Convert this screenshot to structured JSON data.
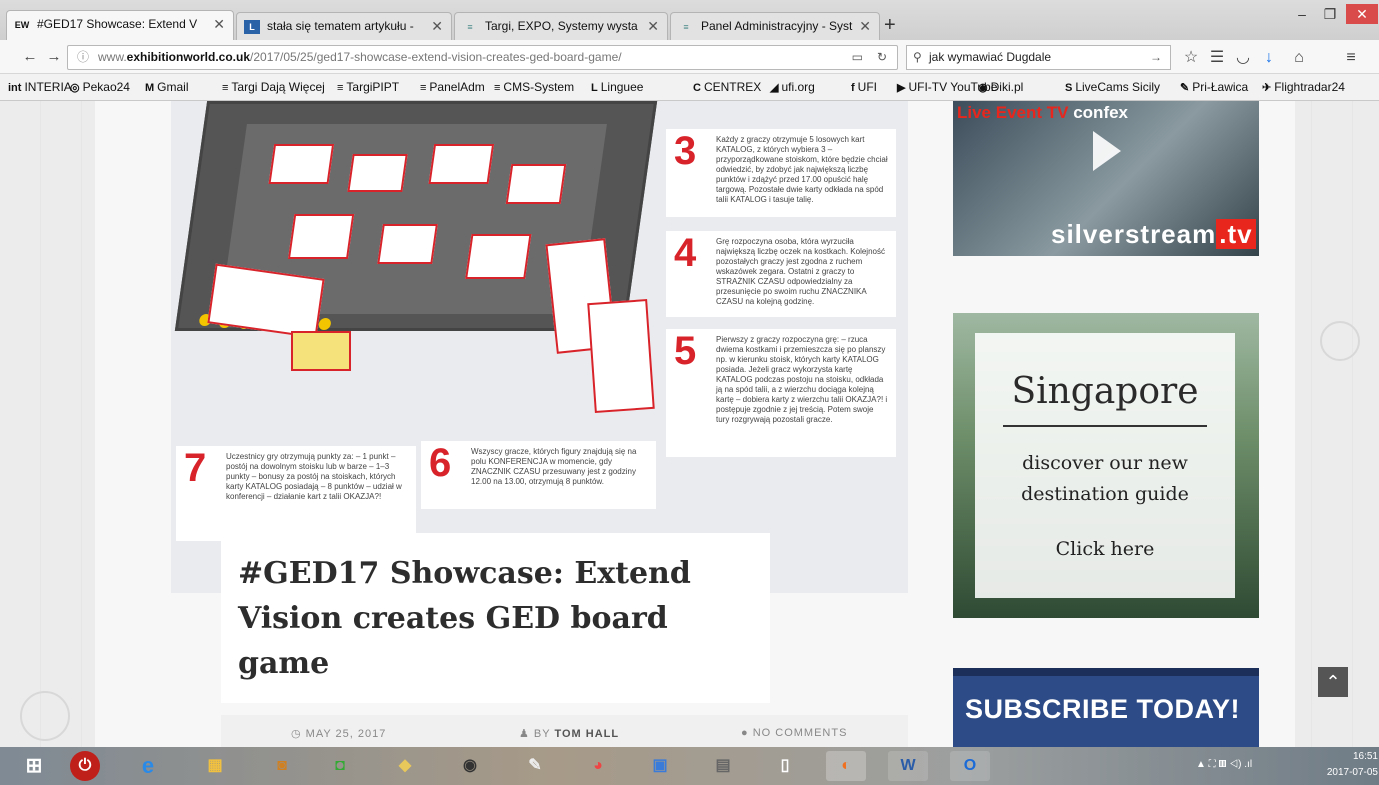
{
  "browser": {
    "tabs": [
      {
        "label": "#GED17 Showcase: Extend V",
        "favicon": "EW",
        "favicon_color": "#1a1a1a",
        "active": true
      },
      {
        "label": "stała się tematem artykułu -",
        "favicon": "L",
        "favicon_color": "#2a62a8",
        "active": false
      },
      {
        "label": "Targi, EXPO, Systemy wysta",
        "favicon": "≡",
        "favicon_color": "#4a8a8a",
        "active": false
      },
      {
        "label": "Panel Administracyjny - Syst",
        "favicon": "≡",
        "favicon_color": "#4a8a8a",
        "active": false
      }
    ],
    "new_tab": "+",
    "window_controls": {
      "minimize": "–",
      "maximize": "❐",
      "close": "✕"
    },
    "url_prefix": "www.",
    "url_domain": "exhibitionworld.co.uk",
    "url_path": "/2017/05/25/ged17-showcase-extend-vision-creates-ged-board-game/",
    "search_value": "jak wymawiać Dugdale",
    "bookmarks": [
      {
        "label": "INTERIA",
        "icon": "int"
      },
      {
        "label": "Pekao24",
        "icon": "◎"
      },
      {
        "label": "Gmail",
        "icon": "M"
      },
      {
        "label": "Targi Dają Więcej",
        "icon": "≡"
      },
      {
        "label": "TargiPIPT",
        "icon": "≡"
      },
      {
        "label": "PanelAdm",
        "icon": "≡"
      },
      {
        "label": "CMS-System",
        "icon": "≡"
      },
      {
        "label": "Linguee",
        "icon": "L"
      },
      {
        "label": "CENTREX",
        "icon": "C"
      },
      {
        "label": "ufi.org",
        "icon": "◢"
      },
      {
        "label": "UFI",
        "icon": "f"
      },
      {
        "label": "UFI-TV YouTube",
        "icon": "▶"
      },
      {
        "label": "Diki.pl",
        "icon": "◉"
      },
      {
        "label": "LiveCams Sicily",
        "icon": "S"
      },
      {
        "label": "Pri-Ławica",
        "icon": "✎"
      },
      {
        "label": "Flightradar24",
        "icon": "✈"
      }
    ]
  },
  "article": {
    "title": "#GED17 Showcase: Extend Vision creates GED board game",
    "date": "MAY 25, 2017",
    "author_prefix": "BY",
    "author": "TOM HALL",
    "comments": "NO COMMENTS",
    "infographic": {
      "step3_num": "3",
      "step3_text": "Każdy z graczy otrzymuje 5 losowych kart KATALOG, z których wybiera 3 – przyporządkowane stoiskom, które będzie chciał odwiedzić, by zdobyć jak największą liczbę punktów i zdążyć przed 17.00 opuścić halę targową. Pozostałe dwie karty odkłada na spód talii KATALOG i tasuje talię.",
      "step4_num": "4",
      "step4_text": "Grę rozpoczyna osoba, która wyrzuciła największą liczbę oczek na kostkach. Kolejność pozostałych graczy jest zgodna z ruchem wskazówek zegara. Ostatni z graczy to STRAŻNIK CZASU odpowiedzialny za przesunięcie po swoim ruchu ZNACZNIKA CZASU na kolejną godzinę.",
      "step5_num": "5",
      "step5_text": "Pierwszy z graczy rozpoczyna grę: – rzuca dwiema kostkami i przemieszcza się po planszy np. w kierunku stoisk, których karty KATALOG posiada. Jeżeli gracz wykorzysta kartę KATALOG podczas postoju na stoisku, odkłada ją na spód talii, a z wierzchu dociąga kolejną kartę – dobiera karty z wierzchu talii OKAZJA?! i postępuje zgodnie z jej treścią. Potem swoje tury rozgrywają pozostali gracze.",
      "step6_num": "6",
      "step6_text": "Wszyscy gracze, których figury znajdują się na polu KONFERENCJA w momencie, gdy ZNACZNIK CZASU przesuwany jest z godziny 12.00 na 13.00, otrzymują 8 punktów.",
      "step7_num": "7",
      "step7_text": "Uczestnicy gry otrzymują punkty za: – 1 punkt – postój na dowolnym stoisku lub w barze – 1–3 punkty – bonusy za postój na stoiskach, których karty KATALOG posiadają – 8 punktów – udział w konferencji – działanie kart z talii OKAZJA?!"
    }
  },
  "ads": {
    "ad1_title": "Live Event TV",
    "ad1_brand": "confex",
    "ad1_logo_main": "silverstream",
    "ad1_logo_suffix": ".tv",
    "ad2_city": "Singapore",
    "ad2_sub": "discover our new destination guide",
    "ad2_cta": "Click here",
    "ad3_text": "SUBSCRIBE TODAY!"
  },
  "taskbar": {
    "icons": [
      "windows-start",
      "power",
      "internet-explorer",
      "file-explorer",
      "app-1",
      "store",
      "folder",
      "speaker",
      "pen",
      "chrome",
      "app-2",
      "app-3",
      "notepad",
      "firefox",
      "word",
      "outlook"
    ],
    "time": "16:51",
    "date": "2017-07-05"
  },
  "colors": {
    "accent_red": "#d8232a",
    "subscribe_blue": "#2d4b86"
  }
}
